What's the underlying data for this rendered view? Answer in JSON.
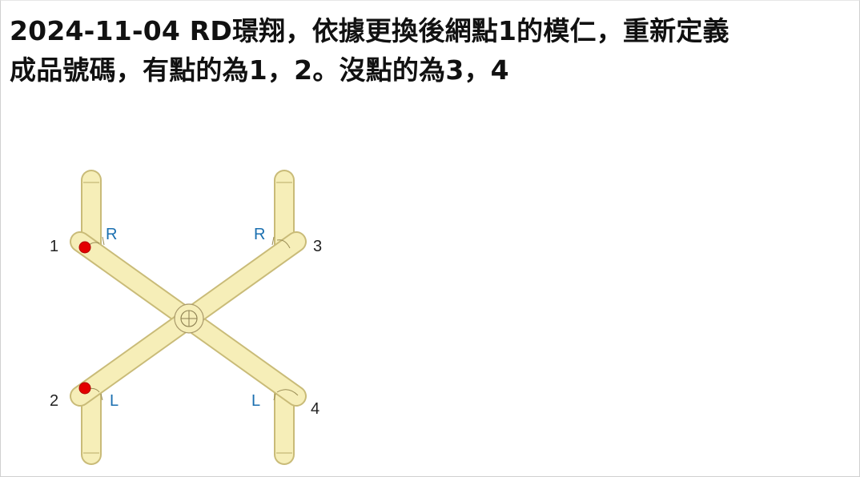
{
  "title": {
    "line1": "2024-11-04 RD璟翔，依據更換後網點1的模仁，重新定義",
    "line2": "成品號碼，有點的為1，2。沒點的為3，4"
  },
  "diagram": {
    "labels": {
      "n1": "1",
      "n2": "2",
      "n3": "3",
      "n4": "4",
      "r_left": "R",
      "r_right": "R",
      "l_left": "L",
      "l_right": "L"
    },
    "colors": {
      "rod": "#f6eeb8",
      "rod_edge": "#c9bb78",
      "dot": "#e30000",
      "side_label": "#1a6fb0"
    }
  }
}
